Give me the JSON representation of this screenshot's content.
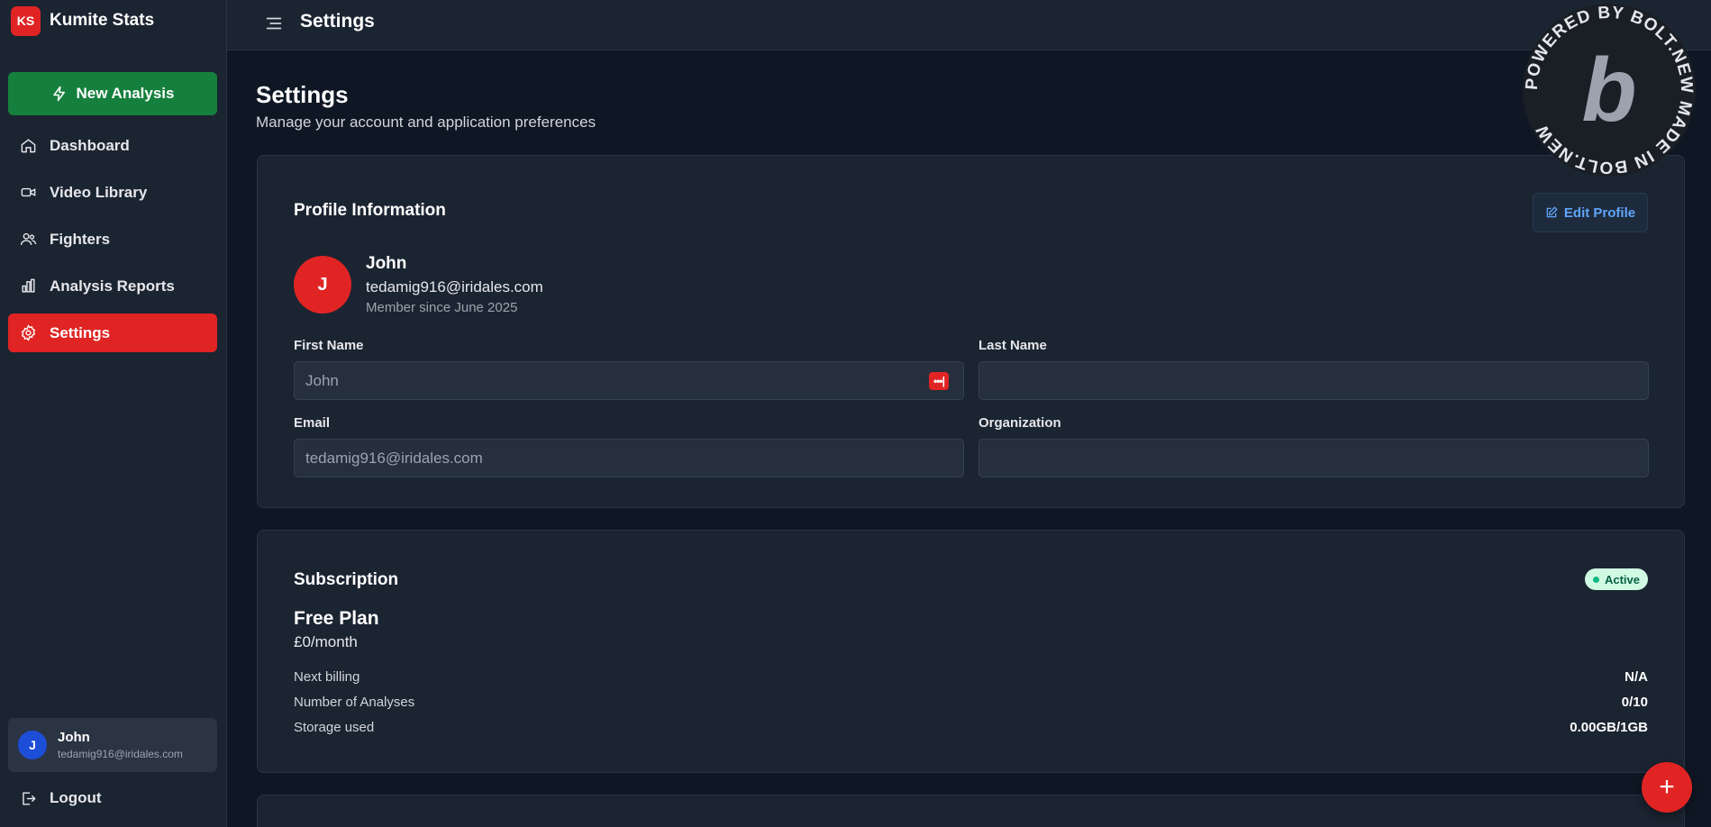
{
  "brand": {
    "logo_text": "KS",
    "name": "Kumite Stats",
    "accent": "#e02424"
  },
  "sidebar": {
    "new_analysis_label": "New Analysis",
    "items": [
      {
        "label": "Dashboard",
        "icon": "home-icon",
        "active": false
      },
      {
        "label": "Video Library",
        "icon": "video-icon",
        "active": false
      },
      {
        "label": "Fighters",
        "icon": "users-icon",
        "active": false
      },
      {
        "label": "Analysis Reports",
        "icon": "bar-chart-icon",
        "active": false
      },
      {
        "label": "Settings",
        "icon": "gear-icon",
        "active": true
      }
    ],
    "user": {
      "initial": "J",
      "name": "John",
      "email": "tedamig916@iridales.com"
    },
    "logout_label": "Logout"
  },
  "topbar": {
    "title": "Settings"
  },
  "page": {
    "title": "Settings",
    "subtitle": "Manage your account and application preferences"
  },
  "profile": {
    "card_title": "Profile Information",
    "edit_label": "Edit Profile",
    "avatar_initial": "J",
    "name": "John",
    "email": "tedamig916@iridales.com",
    "member_since": "Member since June 2025",
    "fields": {
      "first_name": {
        "label": "First Name",
        "value": "John"
      },
      "last_name": {
        "label": "Last Name",
        "value": ""
      },
      "email": {
        "label": "Email",
        "value": "tedamig916@iridales.com"
      },
      "organization": {
        "label": "Organization",
        "value": ""
      }
    },
    "field_icon_text": "•••|"
  },
  "subscription": {
    "card_title": "Subscription",
    "status": "Active",
    "plan_name": "Free Plan",
    "plan_price": "£0/month",
    "rows": [
      {
        "label": "Next billing",
        "value": "N/A"
      },
      {
        "label": "Number of Analyses",
        "value": "0/10"
      },
      {
        "label": "Storage used",
        "value": "0.00GB/1GB"
      }
    ]
  },
  "fab_label": "+",
  "bolt_badge": {
    "ring_text": "POWERED BY BOLT.NEW MADE IN BOLT.NEW",
    "letter": "b"
  }
}
